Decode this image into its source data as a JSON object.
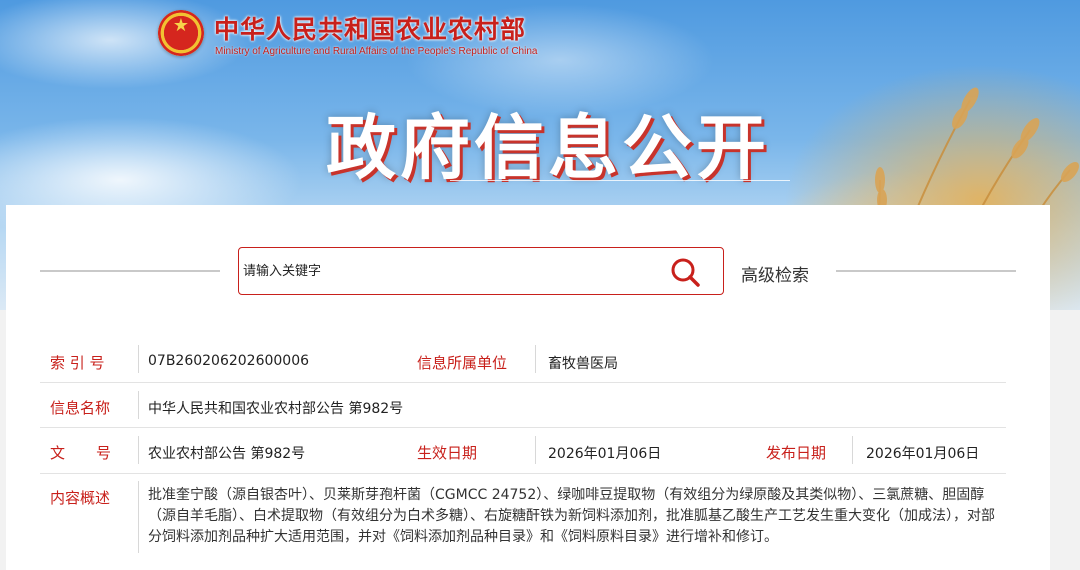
{
  "header": {
    "ministry_cn": "中华人民共和国农业农村部",
    "ministry_en": "Ministry of Agriculture and Rural Affairs of the People's Republic of China",
    "section_title": "政府信息公开",
    "emblem_icon": "national-emblem-icon"
  },
  "search": {
    "placeholder": "请输入关键字",
    "icon": "search-icon",
    "advanced_label": "高级检索"
  },
  "info": {
    "index_label": "索 引 号",
    "index_value": "07B260206202600006",
    "unit_label": "信息所属单位",
    "unit_value": "畜牧兽医局",
    "name_label": "信息名称",
    "name_value": "中华人民共和国农业农村部公告 第982号",
    "doc_label_1": "文",
    "doc_label_2": "号",
    "doc_value": "农业农村部公告 第982号",
    "effective_label": "生效日期",
    "effective_value": "2026年01月06日",
    "publish_label": "发布日期",
    "publish_value": "2026年01月06日",
    "summary_label": "内容概述",
    "summary_value": "批准奎宁酸（源自银杏叶）、贝莱斯芽孢杆菌（CGMCC 24752）、绿咖啡豆提取物（有效组分为绿原酸及其类似物）、三氯蔗糖、胆固醇（源自羊毛脂）、白术提取物（有效组分为白术多糖）、右旋糖酐铁为新饲料添加剂，批准胍基乙酸生产工艺发生重大变化（加成法），对部分饲料添加剂品种扩大适用范围，并对《饲料添加剂品种目录》和《饲料原料目录》进行增补和修订。"
  },
  "colors": {
    "accent": "#c8201b",
    "label": "#c8201b",
    "border": "#e3e3e3"
  }
}
